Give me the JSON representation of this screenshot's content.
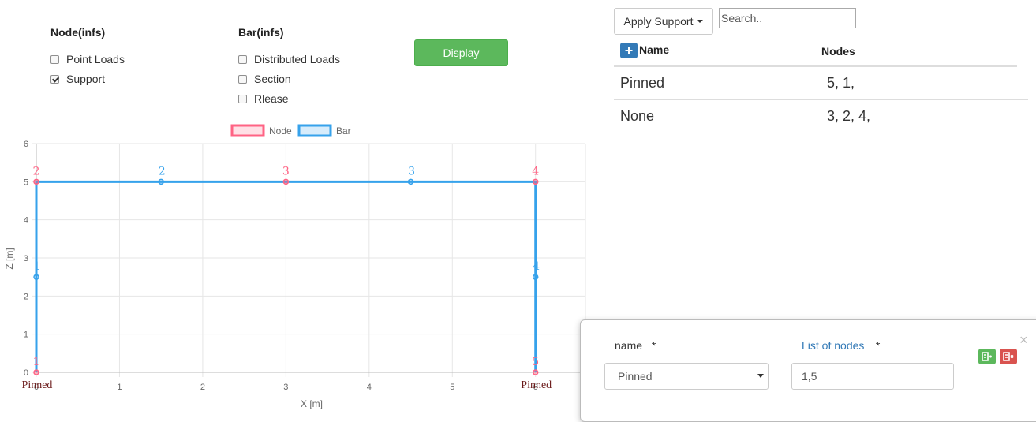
{
  "filters": {
    "node_heading": "Node(infs)",
    "bar_heading": "Bar(infs)",
    "node_options": [
      {
        "label": "Point Loads",
        "checked": false
      },
      {
        "label": "Support",
        "checked": true
      }
    ],
    "bar_options": [
      {
        "label": "Distributed Loads",
        "checked": false
      },
      {
        "label": "Section",
        "checked": false
      },
      {
        "label": "Rlease",
        "checked": false
      }
    ],
    "display_label": "Display"
  },
  "toolbar": {
    "apply_label": "Apply Support",
    "search_placeholder": "Search.."
  },
  "table": {
    "headers": {
      "name": "Name",
      "nodes": "Nodes"
    },
    "rows": [
      {
        "name": "Pinned",
        "nodes": "5, 1,"
      },
      {
        "name": "None",
        "nodes": "3, 2, 4,"
      }
    ]
  },
  "modal": {
    "name_label": "name",
    "nodes_label": "List of nodes",
    "required_mark": "*",
    "name_value": "Pinned",
    "nodes_value": "1,5",
    "close": "×"
  },
  "colors": {
    "node": "#ff6384",
    "bar": "#36a2eb",
    "display_button": "#5cb85c",
    "add_button": "#337ab7",
    "save_button": "#5cb85c",
    "delete_button": "#d9534f"
  },
  "icons": {
    "add": "plus-icon",
    "save": "save-icon",
    "delete": "delete-icon",
    "close": "close-icon",
    "dropdown": "caret-down-icon"
  },
  "chart_data": {
    "type": "scatter",
    "xlabel": "X [m]",
    "ylabel": "Z [m]",
    "xlim": [
      0,
      6.6
    ],
    "ylim": [
      0,
      6
    ],
    "x_ticks": [
      "0",
      "1",
      "2",
      "3",
      "4",
      "5",
      "6"
    ],
    "y_ticks": [
      "0",
      "1",
      "2",
      "3",
      "4",
      "5",
      "6"
    ],
    "grid": true,
    "legend": {
      "position": "top-center",
      "entries": [
        "Node",
        "Bar"
      ]
    },
    "series": [
      {
        "name": "Node",
        "points": [
          {
            "x": 0,
            "y": 0,
            "label": "1"
          },
          {
            "x": 0,
            "y": 5,
            "label": "2"
          },
          {
            "x": 3,
            "y": 5,
            "label": "3"
          },
          {
            "x": 6,
            "y": 5,
            "label": "4"
          },
          {
            "x": 6,
            "y": 0,
            "label": "5"
          }
        ]
      },
      {
        "name": "Bar",
        "midpoints": [
          {
            "x": 0,
            "y": 2.5,
            "label": "1"
          },
          {
            "x": 1.5,
            "y": 5,
            "label": "2"
          },
          {
            "x": 4.5,
            "y": 5,
            "label": "3"
          },
          {
            "x": 6,
            "y": 2.5,
            "label": "4"
          }
        ],
        "path": [
          {
            "x": 0,
            "y": 0
          },
          {
            "x": 0,
            "y": 5
          },
          {
            "x": 6,
            "y": 5
          },
          {
            "x": 6,
            "y": 0
          }
        ]
      }
    ],
    "annotations": [
      {
        "x": 0,
        "y": 0,
        "text": "Pinned"
      },
      {
        "x": 6,
        "y": 0,
        "text": "Pinned"
      }
    ]
  }
}
